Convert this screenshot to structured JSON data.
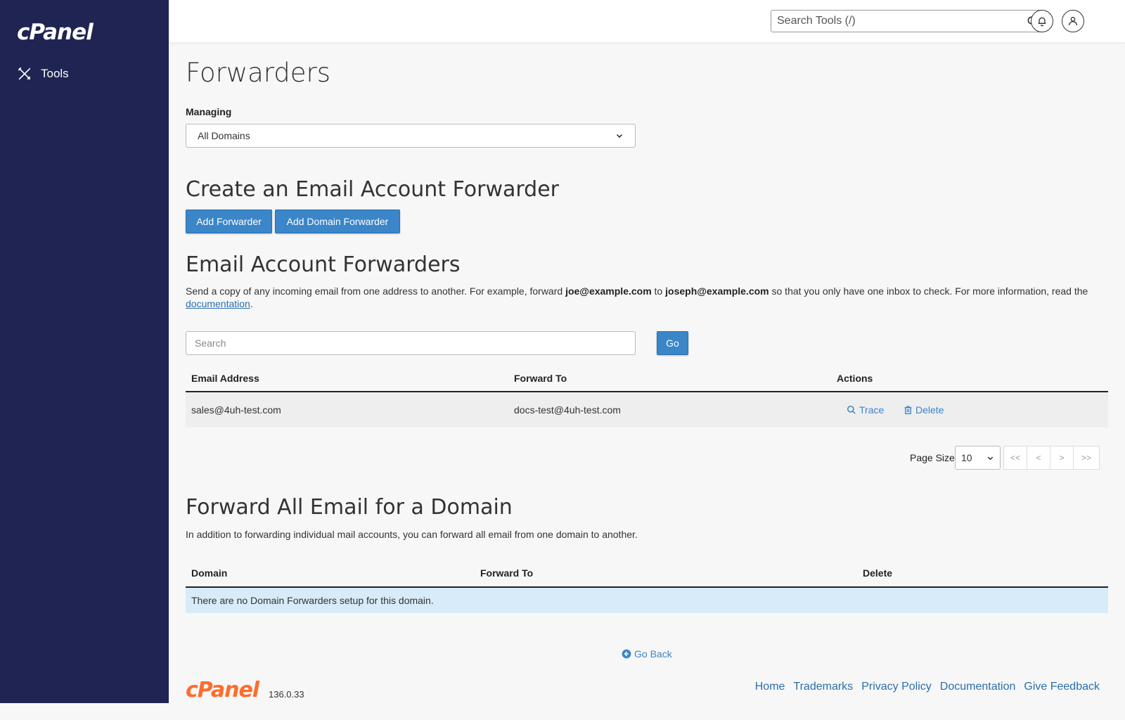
{
  "sidebar": {
    "logo": "cPanel",
    "items": [
      {
        "label": "Tools",
        "icon": "tools-icon"
      }
    ]
  },
  "topbar": {
    "search_placeholder": "Search Tools (/)"
  },
  "page": {
    "title": "Forwarders",
    "managing_label": "Managing",
    "managing_value": "All Domains"
  },
  "create": {
    "heading": "Create an Email Account Forwarder",
    "add_forwarder": "Add Forwarder",
    "add_domain_forwarder": "Add Domain Forwarder"
  },
  "email_forwarders": {
    "heading": "Email Account Forwarders",
    "desc_1": "Send a copy of any incoming email from one address to another. For example, forward ",
    "desc_ex1": "joe@example.com",
    "desc_2": " to ",
    "desc_ex2": "joseph@example.com",
    "desc_3": " so that you only have one inbox to check. For more information, read the ",
    "desc_link": "documentation",
    "desc_4": ".",
    "search_placeholder": "Search",
    "go_label": "Go",
    "columns": [
      "Email Address",
      "Forward To",
      "Actions"
    ],
    "rows": [
      {
        "email": "sales@4uh-test.com",
        "forward_to": "docs-test@4uh-test.com",
        "trace": "Trace",
        "delete": "Delete"
      }
    ],
    "page_size_label": "Page Size",
    "page_size_value": "10",
    "pager": [
      "<<",
      "<",
      ">",
      ">>"
    ]
  },
  "domain_forwarders": {
    "heading": "Forward All Email for a Domain",
    "desc": "In addition to forwarding individual mail accounts, you can forward all email from one domain to another.",
    "columns": [
      "Domain",
      "Forward To",
      "Delete"
    ],
    "empty_message": "There are no Domain Forwarders setup for this domain."
  },
  "go_back": "Go Back",
  "footer": {
    "logo": "cPanel",
    "version": "136.0.33",
    "links": [
      "Home",
      "Trademarks",
      "Privacy Policy",
      "Documentation",
      "Give Feedback"
    ]
  },
  "colors": {
    "sidebar_bg": "#1f2452",
    "accent": "#3b85c9",
    "brand_orange": "#ff6c2c",
    "info_row": "#d7ecf8"
  }
}
